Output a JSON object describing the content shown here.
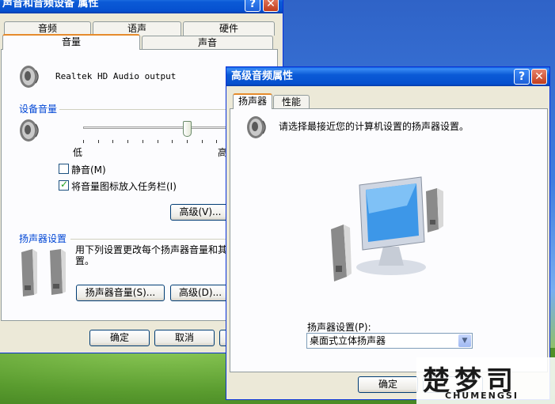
{
  "main_window": {
    "title": "声音和音频设备 属性",
    "help": "?",
    "close": "✕",
    "tabs_row1": [
      "音频",
      "语声",
      "硬件"
    ],
    "tabs_row2": [
      "音量",
      "声音"
    ],
    "device_name": "Realtek HD Audio output",
    "device_volume": {
      "group_label": "设备音量",
      "low_label": "低",
      "high_label": "高",
      "level": 0.71,
      "mute_label": "静音(M)",
      "mute_checked": false,
      "tray_label": "将音量图标放入任务栏(I)",
      "tray_checked": true,
      "advanced_label": "高级(V)..."
    },
    "speakers": {
      "group_label": "扬声器设置",
      "description_line1": "用下列设置更改每个扬声器音量和其",
      "description_line2": "置。",
      "speaker_volume_label": "扬声器音量(S)...",
      "advanced_label": "高级(D)..."
    },
    "ok": "确定",
    "cancel": "取消"
  },
  "adv_window": {
    "title": "高级音频属性",
    "help": "?",
    "close": "✕",
    "tabs": [
      "扬声器",
      "性能"
    ],
    "instruction": "请选择最接近您的计算机设置的扬声器设置。",
    "setup_label": "扬声器设置(P):",
    "setup_value": "桌面式立体扬声器",
    "ok": "确定"
  },
  "watermark": {
    "line1": "楚梦司",
    "line2": "CHUMENGSI"
  }
}
